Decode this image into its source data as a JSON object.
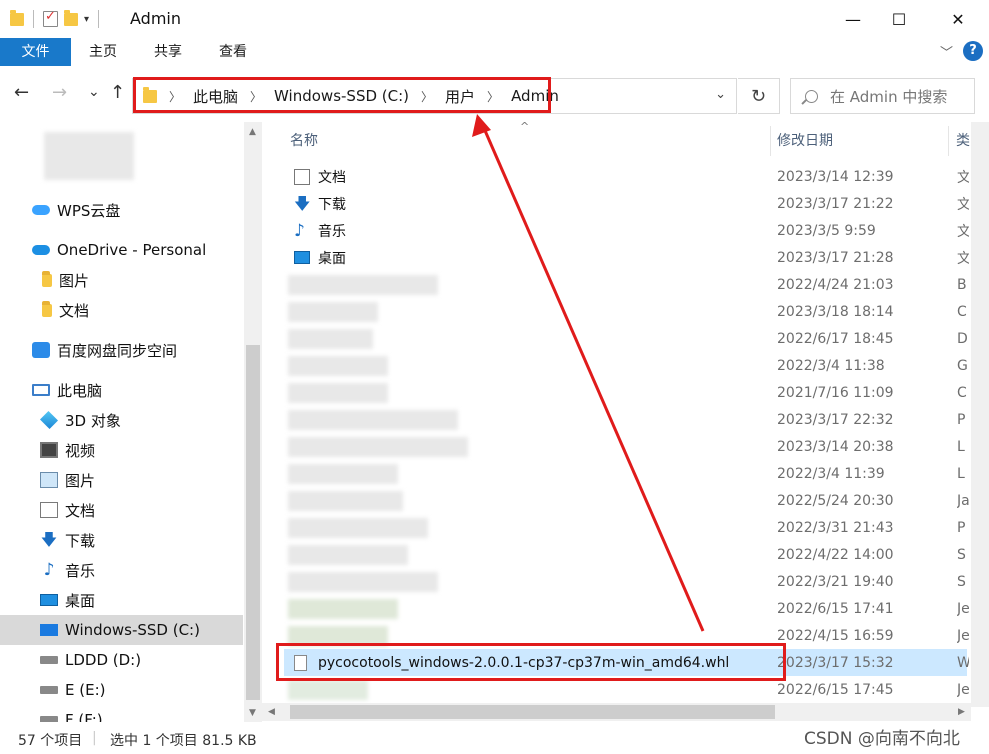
{
  "window": {
    "title": "Admin",
    "minimize": "—",
    "maximize": "☐",
    "close": "✕"
  },
  "ribbon": {
    "tabs": [
      "文件",
      "主页",
      "共享",
      "查看"
    ],
    "expand": "﹀",
    "help": "?"
  },
  "nav": {
    "back": "←",
    "forward": "→",
    "recent": "⌄",
    "up": "↑"
  },
  "address": {
    "crumbs": [
      "此电脑",
      "Windows-SSD (C:)",
      "用户",
      "Admin"
    ],
    "dropdown": "⌄",
    "refresh": "↻"
  },
  "search": {
    "placeholder": "在 Admin 中搜索"
  },
  "sidebar": {
    "items": [
      {
        "label": "WPS云盘",
        "icon": "wps-cloud-icon"
      },
      {
        "label": "OneDrive - Personal",
        "icon": "onedrive-icon"
      },
      {
        "label": "图片",
        "icon": "folder-icon"
      },
      {
        "label": "文档",
        "icon": "folder-icon"
      },
      {
        "label": "百度网盘同步空间",
        "icon": "baidu-netdisk-icon"
      },
      {
        "label": "此电脑",
        "icon": "this-pc-icon"
      },
      {
        "label": "3D 对象",
        "icon": "3d-objects-icon"
      },
      {
        "label": "视频",
        "icon": "video-icon"
      },
      {
        "label": "图片",
        "icon": "pictures-icon"
      },
      {
        "label": "文档",
        "icon": "documents-icon"
      },
      {
        "label": "下载",
        "icon": "downloads-icon"
      },
      {
        "label": "音乐",
        "icon": "music-icon"
      },
      {
        "label": "桌面",
        "icon": "desktop-icon"
      },
      {
        "label": "Windows-SSD (C:)",
        "icon": "windows-drive-icon"
      },
      {
        "label": "LDDD (D:)",
        "icon": "drive-icon"
      },
      {
        "label": "E (E:)",
        "icon": "drive-icon"
      },
      {
        "label": "F (F:)",
        "icon": "drive-icon"
      }
    ]
  },
  "columns": {
    "name": "名称",
    "date": "修改日期",
    "type": "类"
  },
  "files": [
    {
      "name": "文档",
      "date": "2023/3/14 12:39",
      "type": "文"
    },
    {
      "name": "下载",
      "date": "2023/3/17 21:22",
      "type": "文"
    },
    {
      "name": "音乐",
      "date": "2023/3/5 9:59",
      "type": "文"
    },
    {
      "name": "桌面",
      "date": "2023/3/17 21:28",
      "type": "文"
    },
    {
      "name": "",
      "date": "2022/4/24 21:03",
      "type": "B"
    },
    {
      "name": "",
      "date": "2023/3/18 18:14",
      "type": "C"
    },
    {
      "name": "",
      "date": "2022/6/17 18:45",
      "type": "D"
    },
    {
      "name": "",
      "date": "2022/3/4 11:38",
      "type": "G"
    },
    {
      "name": "",
      "date": "2021/7/16 11:09",
      "type": "C"
    },
    {
      "name": "",
      "date": "2023/3/17 22:32",
      "type": "P"
    },
    {
      "name": "",
      "date": "2023/3/14 20:38",
      "type": "L"
    },
    {
      "name": "",
      "date": "2022/3/4 11:39",
      "type": "L"
    },
    {
      "name": "",
      "date": "2022/5/24 20:30",
      "type": "Ja"
    },
    {
      "name": "",
      "date": "2022/3/31 21:43",
      "type": "P"
    },
    {
      "name": "",
      "date": "2022/4/22 14:00",
      "type": "S"
    },
    {
      "name": "",
      "date": "2022/3/21 19:40",
      "type": "S"
    },
    {
      "name": "",
      "date": "2022/6/15 17:41",
      "type": "Je"
    },
    {
      "name": "",
      "date": "2022/4/15 16:59",
      "type": "Je"
    },
    {
      "name": "pycocotools_windows-2.0.0.1-cp37-cp37m-win_amd64.whl",
      "date": "2023/3/17 15:32",
      "type": "W"
    },
    {
      "name": "",
      "date": "2022/6/15 17:45",
      "type": "Je"
    }
  ],
  "status": {
    "count": "57 个项目",
    "selected": "选中 1 个项目  81.5 KB"
  },
  "watermark": "CSDN @向南不向北",
  "annotation_color": "#e01b1b"
}
